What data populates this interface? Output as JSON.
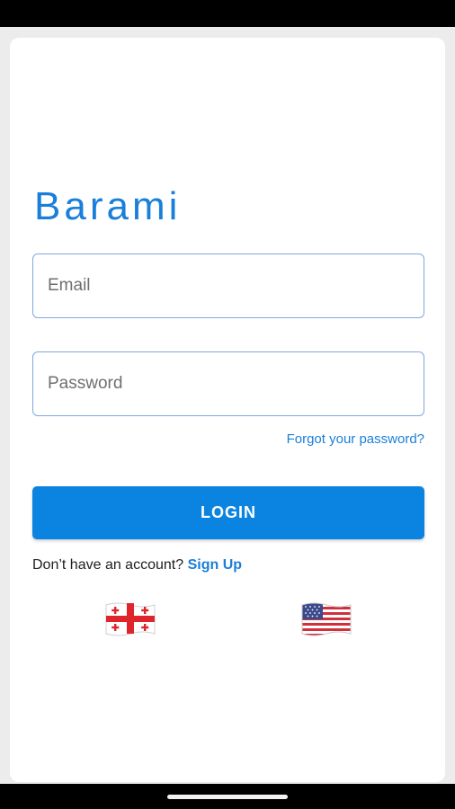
{
  "app": {
    "brand": "Barami"
  },
  "form": {
    "email_placeholder": "Email",
    "password_placeholder": "Password",
    "forgot_label": "Forgot your password?",
    "login_label": "LOGIN",
    "signup_prompt": "Don’t have an account?",
    "signup_label": "Sign Up"
  },
  "languages": [
    {
      "icon": "georgia-flag-icon"
    },
    {
      "icon": "usa-flag-icon"
    }
  ],
  "colors": {
    "accent": "#1a7fd9",
    "button": "#0a84e0",
    "field_border": "#7fa7e0",
    "background": "#ececec"
  }
}
